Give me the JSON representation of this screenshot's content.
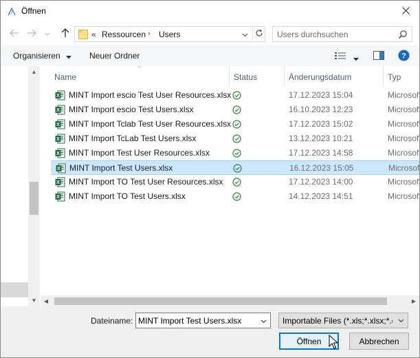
{
  "window": {
    "title": "Öffnen"
  },
  "nav": {
    "breadcrumb_prefix": "«",
    "breadcrumbs": [
      "Ressourcen",
      "Users"
    ],
    "search_placeholder": "Users durchsuchen"
  },
  "toolbar": {
    "organize_label": "Organisieren",
    "new_folder_label": "Neuer Ordner"
  },
  "columns": {
    "name": "Name",
    "status": "Status",
    "date": "Änderungsdatum",
    "type": "Typ"
  },
  "files": [
    {
      "name": "MINT Import escio Test User Resources.xlsx",
      "date": "17.12.2023 15:04",
      "type": "Microsoft Excel-Arbeitsblatt",
      "selected": false
    },
    {
      "name": "MINT Import escio Test Users.xlsx",
      "date": "16.10.2023 12:23",
      "type": "Microsoft Excel-Arbeitsblatt",
      "selected": false
    },
    {
      "name": "MINT Import Tclab Test User Resources.xlsx",
      "date": "17.12.2023 15:02",
      "type": "Microsoft Excel-Arbeitsblatt",
      "selected": false
    },
    {
      "name": "MINT Import TcLab Test Users.xlsx",
      "date": "13.12.2023 10:21",
      "type": "Microsoft Excel-Arbeitsblatt",
      "selected": false
    },
    {
      "name": "MINT Import Test User Resources.xlsx",
      "date": "17.12.2023 14:58",
      "type": "Microsoft Excel-Arbeitsblatt",
      "selected": false
    },
    {
      "name": "MINT Import Test Users.xlsx",
      "date": "16.12.2023 15:05",
      "type": "Microsoft Excel-Arbeitsblatt",
      "selected": true
    },
    {
      "name": "MINT Import TO Test User Resources.xlsx",
      "date": "17.12.2023 14:00",
      "type": "Microsoft Excel-Arbeitsblatt",
      "selected": false
    },
    {
      "name": "MINT Import TO Test Users.xlsx",
      "date": "14.12.2023 14:51",
      "type": "Microsoft Excel-Arbeitsblatt",
      "selected": false
    }
  ],
  "bottom": {
    "filename_label": "Dateiname:",
    "filename_value": "MINT Import Test Users.xlsx",
    "filter_label": "Importable Files (*.xls;*.xlsx;*.csv)",
    "open_label": "Öffnen",
    "cancel_label": "Abbrechen"
  },
  "colors": {
    "selection": "#cce8ff",
    "accent": "#0078d7",
    "excel_green": "#1d6f42",
    "status_green": "#2e8b3a"
  }
}
